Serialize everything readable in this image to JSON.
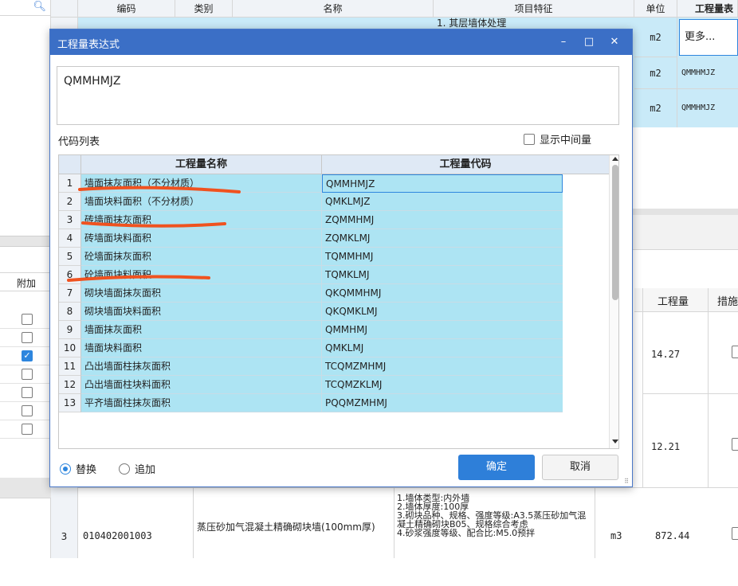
{
  "left_panel": {
    "search_icon": "search-icon",
    "header": "附加",
    "checkboxes": [
      false,
      false,
      true,
      false,
      false,
      false,
      false
    ]
  },
  "top_table": {
    "headers": [
      "编码",
      "类别",
      "名称",
      "项目特征",
      "单位",
      "工程量表"
    ],
    "rows": [
      {
        "feature": "1. 其层墙体处理",
        "unit": "m2",
        "expr": "更多..."
      },
      {
        "unit": "m2",
        "expr": "QMMHMJZ"
      },
      {
        "unit": "m2",
        "expr": "QMMHMJZ"
      }
    ]
  },
  "right_table": {
    "header_qty": "工程量",
    "header_measure": "措施",
    "qty1": "14.27",
    "qty2": "12.21"
  },
  "bottom_row": {
    "index": "3",
    "code": "010402001003",
    "name": "蒸压砂加气混凝土精确砌块墙(100mm厚)",
    "features": "1.墙体类型:内外墙\n2.墙体厚度:100厚\n3.砌块品种、规格、强度等级:A3.5蒸压砂加气混凝土精确砌块B05、规格综合考虑\n4.砂浆强度等级、配合比:M5.0预拌",
    "unit": "m3",
    "qty": "872.44"
  },
  "dialog": {
    "title": "工程量表达式",
    "expression": "QMMHMJZ",
    "list_label": "代码列表",
    "show_intermediate": "显示中间量",
    "col_name": "工程量名称",
    "col_code": "工程量代码",
    "rows": [
      {
        "n": "1",
        "name": "墙面抹灰面积（不分材质）",
        "code": "QMMHMJZ"
      },
      {
        "n": "2",
        "name": "墙面块料面积（不分材质）",
        "code": "QMKLMJZ"
      },
      {
        "n": "3",
        "name": "砖墙面抹灰面积",
        "code": "ZQMMHMJ"
      },
      {
        "n": "4",
        "name": "砖墙面块料面积",
        "code": "ZQMKLMJ"
      },
      {
        "n": "5",
        "name": "砼墙面抹灰面积",
        "code": "TQMMHMJ"
      },
      {
        "n": "6",
        "name": "砼墙面块料面积",
        "code": "TQMKLMJ"
      },
      {
        "n": "7",
        "name": "砌块墙面抹灰面积",
        "code": "QKQMMHMJ"
      },
      {
        "n": "8",
        "name": "砌块墙面块料面积",
        "code": "QKQMKLMJ"
      },
      {
        "n": "9",
        "name": "墙面抹灰面积",
        "code": "QMMHMJ"
      },
      {
        "n": "10",
        "name": "墙面块料面积",
        "code": "QMKLMJ"
      },
      {
        "n": "11",
        "name": "凸出墙面柱抹灰面积",
        "code": "TCQMZMHMJ"
      },
      {
        "n": "12",
        "name": "凸出墙面柱块料面积",
        "code": "TCQMZKLMJ"
      },
      {
        "n": "13",
        "name": "平齐墙面柱抹灰面积",
        "code": "PQQMZMHMJ"
      }
    ],
    "replace": "替换",
    "append": "追加",
    "ok": "确定",
    "cancel": "取消",
    "colors": {
      "title_bar": "#3b6fc6",
      "row_fill": "#ade4f3",
      "ok_button": "#2e7fd9",
      "annotation": "#f0521f"
    }
  }
}
